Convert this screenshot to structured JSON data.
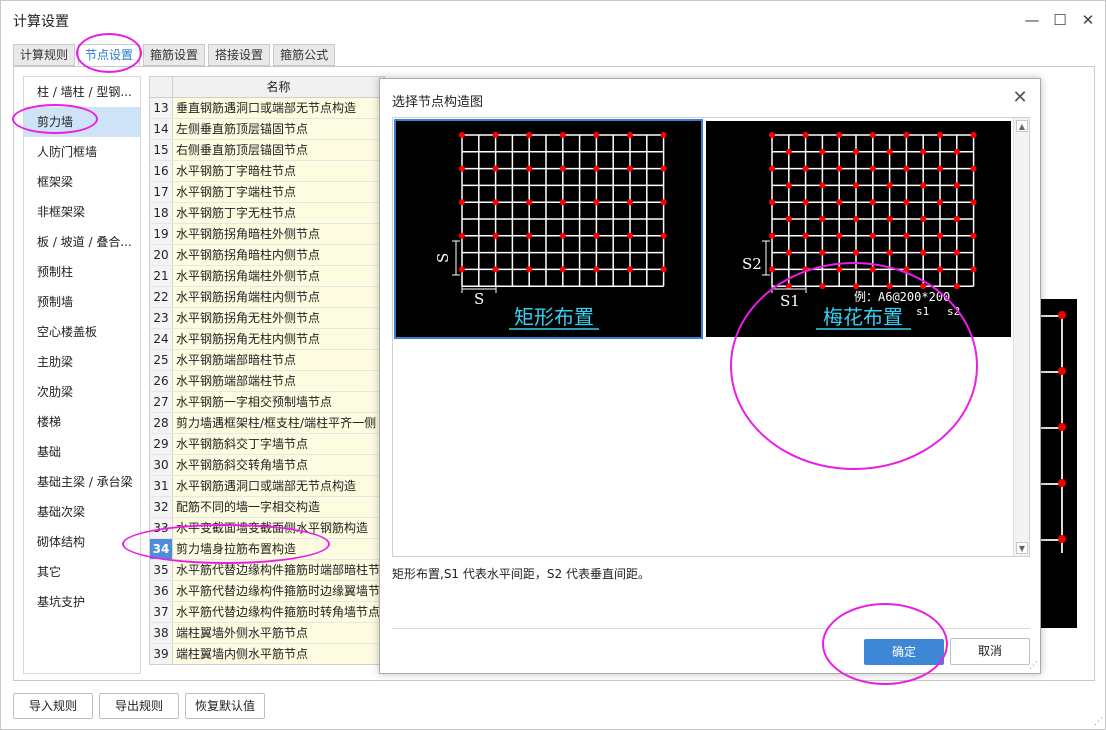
{
  "window": {
    "title": "计算设置"
  },
  "tabs": [
    {
      "label": "计算规则",
      "active": false
    },
    {
      "label": "节点设置",
      "active": true
    },
    {
      "label": "箍筋设置",
      "active": false
    },
    {
      "label": "搭接设置",
      "active": false
    },
    {
      "label": "箍筋公式",
      "active": false
    }
  ],
  "categories": [
    "柱 / 墙柱 / 型钢...",
    "剪力墙",
    "人防门框墙",
    "框架梁",
    "非框架梁",
    "板 / 坡道 / 叠合...",
    "预制柱",
    "预制墙",
    "空心楼盖板",
    "主肋梁",
    "次肋梁",
    "楼梯",
    "基础",
    "基础主梁 / 承台梁",
    "基础次梁",
    "砌体结构",
    "其它",
    "基坑支护"
  ],
  "selected_category_index": 1,
  "grid": {
    "header": "名称",
    "rows": [
      {
        "num": "13",
        "name": "垂直钢筋遇洞口或端部无节点构造"
      },
      {
        "num": "14",
        "name": "左侧垂直筋顶层锚固节点"
      },
      {
        "num": "15",
        "name": "右侧垂直筋顶层锚固节点"
      },
      {
        "num": "16",
        "name": "水平钢筋丁字暗柱节点"
      },
      {
        "num": "17",
        "name": "水平钢筋丁字端柱节点"
      },
      {
        "num": "18",
        "name": "水平钢筋丁字无柱节点"
      },
      {
        "num": "19",
        "name": "水平钢筋拐角暗柱外侧节点"
      },
      {
        "num": "20",
        "name": "水平钢筋拐角暗柱内侧节点"
      },
      {
        "num": "21",
        "name": "水平钢筋拐角端柱外侧节点"
      },
      {
        "num": "22",
        "name": "水平钢筋拐角端柱内侧节点"
      },
      {
        "num": "23",
        "name": "水平钢筋拐角无柱外侧节点"
      },
      {
        "num": "24",
        "name": "水平钢筋拐角无柱内侧节点"
      },
      {
        "num": "25",
        "name": "水平钢筋端部暗柱节点"
      },
      {
        "num": "26",
        "name": "水平钢筋端部端柱节点"
      },
      {
        "num": "27",
        "name": "水平钢筋一字相交预制墙节点"
      },
      {
        "num": "28",
        "name": "剪力墙遇框架柱/框支柱/端柱平齐一侧"
      },
      {
        "num": "29",
        "name": "水平钢筋斜交丁字墙节点"
      },
      {
        "num": "30",
        "name": "水平钢筋斜交转角墙节点"
      },
      {
        "num": "31",
        "name": "水平钢筋遇洞口或端部无节点构造"
      },
      {
        "num": "32",
        "name": "配筋不同的墙一字相交构造"
      },
      {
        "num": "33",
        "name": "水平变截面墙变截面侧水平钢筋构造"
      },
      {
        "num": "34",
        "name": "剪力墙身拉筋布置构造"
      },
      {
        "num": "35",
        "name": "水平筋代替边缘构件箍筋时端部暗柱节点"
      },
      {
        "num": "36",
        "name": "水平筋代替边缘构件箍筋时边缘翼墙节点"
      },
      {
        "num": "37",
        "name": "水平筋代替边缘构件箍筋时转角墙节点"
      },
      {
        "num": "38",
        "name": "端柱翼墙外侧水平筋节点"
      },
      {
        "num": "39",
        "name": "端柱翼墙内侧水平筋节点"
      }
    ],
    "selected_num": "34"
  },
  "bottom_buttons": {
    "import": "导入规则",
    "export": "导出规则",
    "restore": "恢复默认值"
  },
  "dialog": {
    "title": "选择节点构造图",
    "options": [
      {
        "caption": "矩形布置",
        "spacing_labels": [
          "S",
          "S"
        ],
        "selected": true
      },
      {
        "caption": "梅花布置",
        "spacing_labels": [
          "S2",
          "S1"
        ],
        "example": "例：A6@200*200",
        "example_sub": [
          "s1",
          "s2"
        ],
        "selected": false
      }
    ],
    "description": "矩形布置,S1 代表水平间距，S2 代表垂直间距。",
    "ok": "确定",
    "cancel": "取消"
  },
  "colors": {
    "accent": "#3d87d6",
    "selection": "#cfe3f6",
    "highlight_mark": "#e91ee6",
    "rebar_dot": "#ff0000",
    "caption": "#35d0f0"
  }
}
